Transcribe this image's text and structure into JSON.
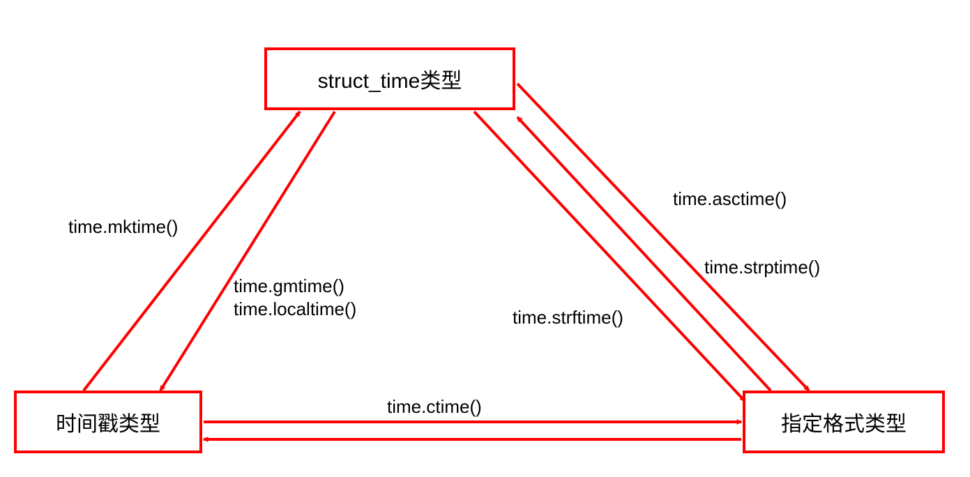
{
  "nodes": {
    "top": {
      "label": "struct_time类型"
    },
    "left": {
      "label": "时间戳类型"
    },
    "right": {
      "label": "指定格式类型"
    }
  },
  "edges": {
    "left_to_top_up": {
      "label": "time.mktime()"
    },
    "top_to_left_down1": {
      "label": "time.gmtime()"
    },
    "top_to_left_down2": {
      "label": "time.localtime()"
    },
    "top_to_right_down": {
      "label": "time.asctime()"
    },
    "right_to_top_up": {
      "label": "time.strptime()"
    },
    "top_to_right_inner": {
      "label": "time.strftime()"
    },
    "left_right_upper": {
      "label": "time.ctime()"
    }
  }
}
